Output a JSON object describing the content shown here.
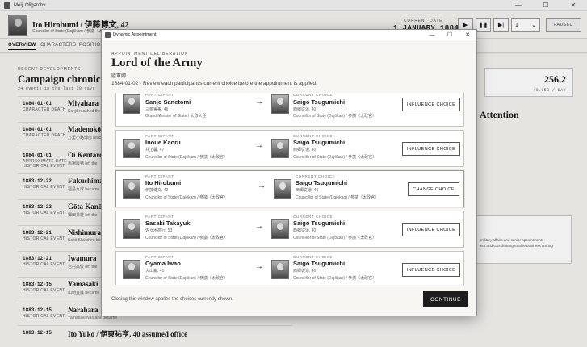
{
  "app": {
    "title": "Meiji Oligarchy",
    "window_controls": [
      "—",
      "☐",
      "✕"
    ]
  },
  "header": {
    "name": "Ito Hirobumi  /  伊藤博文, 42",
    "subtitle": "Councilor of State (Dajōkan)  /  参議（太政官）",
    "date_label": "CURRENT DATE",
    "date_value": "1 JANUARY 1884",
    "speed_value": "1",
    "paused_label": "PAUSED"
  },
  "tabs": [
    "OVERVIEW",
    "CHARACTERS",
    "POSITIONS"
  ],
  "main": {
    "recent_label": "RECENT DEVELOPMENTS",
    "campaign_title": "Campaign chronicle",
    "events_count": "24 events in the last 30 days",
    "events": [
      {
        "date": "1884-01-01",
        "type": "CHARACTER DEATH",
        "title": "Miyahara",
        "desc": "Sanjō reached the"
      },
      {
        "date": "1884-01-01",
        "type": "CHARACTER DEATH",
        "title": "Madenokōji",
        "desc": "万里小路博房 reached"
      },
      {
        "date": "1884-01-01",
        "type": "APPROXIMATE DATE HISTORICAL EVENT",
        "title": "Oi Kentaro",
        "desc": "馬場辰猪 left the"
      },
      {
        "date": "1883-12-22",
        "type": "HISTORICAL EVENT",
        "title": "Fukushima",
        "desc": "福島九成 became"
      },
      {
        "date": "1883-12-22",
        "type": "HISTORICAL EVENT",
        "title": "Gōta Kanō",
        "desc": "郷田兼雄 left the"
      },
      {
        "date": "1883-12-21",
        "type": "HISTORICAL EVENT",
        "title": "Nishimura",
        "desc": "Saitō Shūichirō became"
      },
      {
        "date": "1883-12-21",
        "type": "HISTORICAL EVENT",
        "title": "Iwamura",
        "desc": "岩村高俊 left the"
      },
      {
        "date": "1883-12-15",
        "type": "HISTORICAL EVENT",
        "title": "Yamasaki",
        "desc": "山崎直胤 became"
      },
      {
        "date": "1883-12-15",
        "type": "HISTORICAL EVENT",
        "title": "Narahara",
        "desc": "Yamasaki Naotane became"
      },
      {
        "date": "1883-12-15",
        "type": "",
        "title": "Ito Yuko  /  伊東祐亨, 40  assumed office",
        "desc": ""
      }
    ],
    "metric_value": "256.2",
    "metric_rate": "+0.053 / DAY",
    "attention_title": "Attention",
    "bg_card_lines": [
      "military affairs and senior appointments",
      "ent and coordinating routine business among"
    ]
  },
  "modal": {
    "window_title": "Dynamic Appointment",
    "window_controls": [
      "—",
      "☐",
      "✕"
    ],
    "eyebrow": "APPOINTMENT DELIBERATION",
    "title": "Lord of the Army",
    "title_jp": "陸軍卿",
    "instruction": "1884-01-02 · Review each participant's current choice before the appointment is applied.",
    "participant_label": "PARTICIPANT",
    "choice_label": "CURRENT CHOICE",
    "rows": [
      {
        "name": "Sanjo Sanetomi",
        "jp": "三条実美, 46",
        "office": "Grand Minister of State  /  太政大臣",
        "choice_name": "Saigo Tsugumichi",
        "choice_jp": "西郷従道, 40",
        "choice_office": "Councillor of State (Dajōkan)  /  参議（太政官）",
        "button": "INFLUENCE CHOICE"
      },
      {
        "name": "Inoue Kaoru",
        "jp": "井上馨, 47",
        "office": "Councilor of State (Dajōkan)  /  参議（太政官）",
        "choice_name": "Saigo Tsugumichi",
        "choice_jp": "西郷従道, 40",
        "choice_office": "Councillor of State (Dajōkan)  /  参議（太政官）",
        "button": "INFLUENCE CHOICE"
      },
      {
        "name": "Ito Hirobumi",
        "jp": "伊藤博文, 42",
        "office": "Councilor of State (Dajōkan)  /  参議（太政官）",
        "choice_name": "Saigo Tsugumichi",
        "choice_jp": "西郷従道, 40",
        "choice_office": "Councillor of State (Dajōkan)  /  参議（太政官）",
        "button": "CHANGE CHOICE"
      },
      {
        "name": "Sasaki Takayuki",
        "jp": "佐々木高行, 53",
        "office": "Councilor of State (Dajōkan)  /  参議（太政官）",
        "choice_name": "Saigo Tsugumichi",
        "choice_jp": "西郷従道, 40",
        "choice_office": "Councillor of State (Dajōkan)  /  参議（太政官）",
        "button": "INFLUENCE CHOICE"
      },
      {
        "name": "Oyama Iwao",
        "jp": "大山巌, 41",
        "office": "Councilor of State (Dajōkan)  /  参議（太政官）",
        "choice_name": "Saigo Tsugumichi",
        "choice_jp": "西郷従道, 40",
        "choice_office": "Councillor of State (Dajōkan)  /  参議（太政官）",
        "button": "INFLUENCE CHOICE"
      }
    ],
    "footer_text": "Closing this window applies the choices currently shown.",
    "continue_label": "CONTINUE"
  }
}
